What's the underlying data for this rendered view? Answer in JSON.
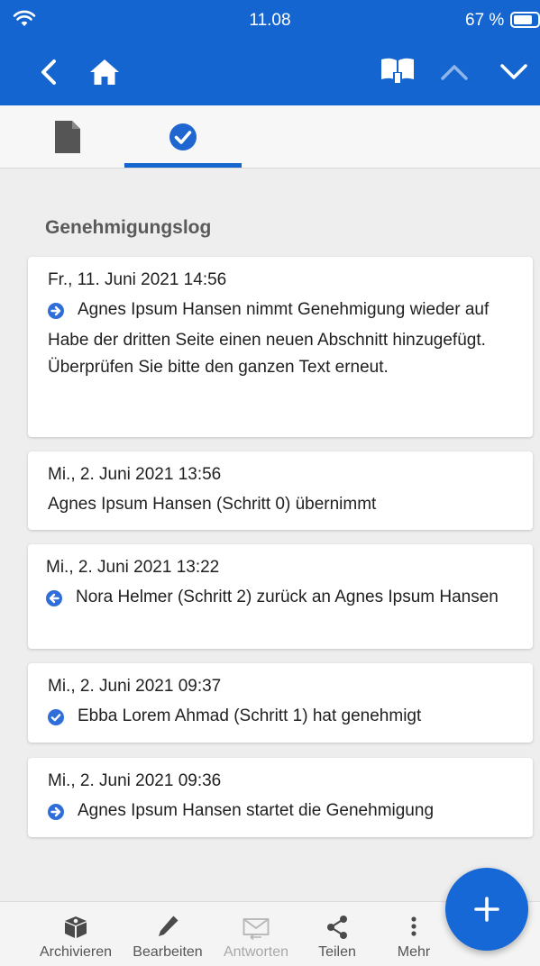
{
  "status_bar": {
    "time": "11.08",
    "battery_percent": "67 %"
  },
  "section": {
    "title": "Genehmigungslog"
  },
  "log_entries": [
    {
      "date": "Fr., 11. Juni 2021 14:56",
      "icon": "arrow-right-circle-icon",
      "text": "Agnes Ipsum Hansen nimmt Genehmigung wieder auf",
      "comment": "Habe der dritten Seite einen neuen Abschnitt hinzugefügt. Überprüfen Sie bitte den ganzen Text erneut."
    },
    {
      "date": "Mi., 2. Juni 2021 13:56",
      "icon": "",
      "text": "Agnes Ipsum Hansen (Schritt 0) übernimmt"
    },
    {
      "date": "Mi., 2. Juni 2021 13:22",
      "icon": "arrow-left-circle-icon",
      "text": "Nora Helmer (Schritt 2) zurück an Agnes Ipsum Hansen"
    },
    {
      "date": "Mi., 2. Juni 2021 09:37",
      "icon": "check-circle-icon",
      "text": "Ebba Lorem Ahmad (Schritt 1) hat genehmigt"
    },
    {
      "date": "Mi., 2. Juni 2021 09:36",
      "icon": "arrow-right-circle-icon",
      "text": "Agnes Ipsum Hansen startet die Genehmigung"
    }
  ],
  "bottom_bar": {
    "items": [
      {
        "label": "Archivieren",
        "icon": "archive-box-icon",
        "enabled": true
      },
      {
        "label": "Bearbeiten",
        "icon": "pencil-icon",
        "enabled": true
      },
      {
        "label": "Antworten",
        "icon": "envelope-reply-icon",
        "enabled": false
      },
      {
        "label": "Teilen",
        "icon": "share-icon",
        "enabled": true
      },
      {
        "label": "Mehr",
        "icon": "more-vertical-icon",
        "enabled": true
      }
    ]
  },
  "colors": {
    "primary": "#1565d0",
    "icon_blue": "#2f6ed9",
    "background": "#eeeeee",
    "card": "#ffffff"
  }
}
